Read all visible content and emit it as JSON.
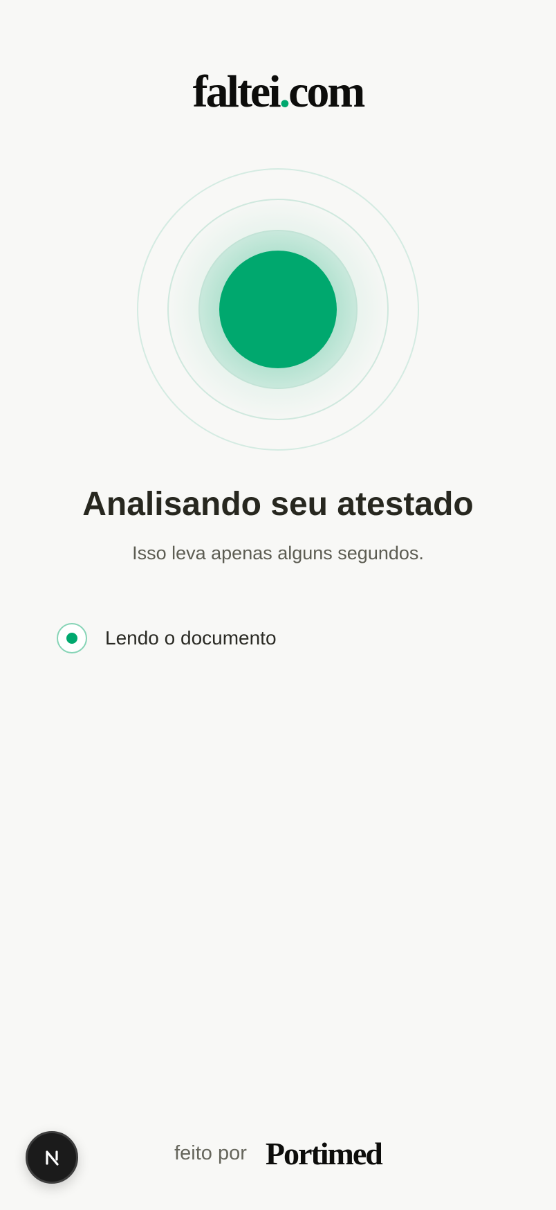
{
  "brand": {
    "name_main": "faltei",
    "name_dot": ".",
    "name_tld": "com",
    "accent_color": "#00a86e"
  },
  "status": {
    "title": "Analisando seu atestado",
    "subtitle": "Isso leva apenas alguns segundos."
  },
  "steps": [
    {
      "label": "Lendo o documento",
      "state": "active"
    }
  ],
  "footer": {
    "made_by": "feito por",
    "company": "Portimed"
  },
  "dev_badge": {
    "icon": "nextjs-icon"
  }
}
